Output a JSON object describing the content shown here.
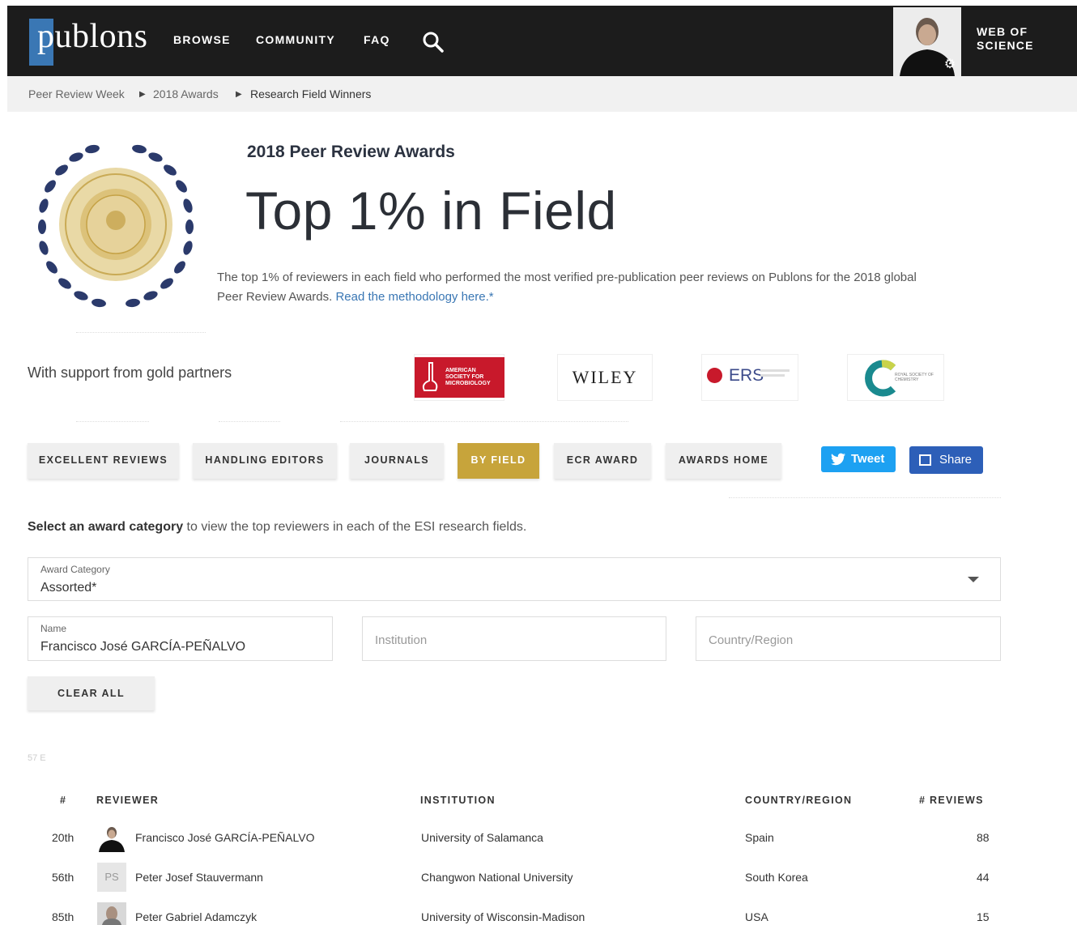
{
  "header": {
    "logo_text": "publons",
    "nav": [
      "BROWSE",
      "COMMUNITY",
      "FAQ"
    ],
    "wos_line1": "WEB OF",
    "wos_line2": "SCIENCE"
  },
  "breadcrumb": [
    "Peer Review Week",
    "2018 Awards",
    "Research Field Winners"
  ],
  "hero": {
    "kicker": "2018 Peer Review Awards",
    "title": "Top 1% in Field",
    "desc_text": "The top 1% of reviewers in each field who performed the most verified pre-publication peer reviews on Publons for the 2018 global Peer Review Awards.",
    "desc_link": "Read the methodology here.*"
  },
  "partners": {
    "label": "With support from gold partners",
    "asm_text": "AMERICAN SOCIETY FOR MICROBIOLOGY",
    "wiley": "WILEY",
    "ers": "ERS",
    "rsc": "ROYAL SOCIETY OF CHEMISTRY"
  },
  "tabs": [
    "EXCELLENT REVIEWS",
    "HANDLING EDITORS",
    "JOURNALS",
    "BY FIELD",
    "ECR AWARD",
    "AWARDS HOME"
  ],
  "social": {
    "tweet": "Tweet",
    "share": "Share"
  },
  "filters": {
    "intro_bold": "Select an award category",
    "intro_rest": " to view the top reviewers in each of the ESI research fields.",
    "category_label": "Award Category",
    "category_value": "Assorted*",
    "name_label": "Name",
    "name_value": "Francisco José GARCÍA-PEÑALVO",
    "institution_placeholder": "Institution",
    "country_placeholder": "Country/Region",
    "clear": "CLEAR ALL"
  },
  "result_count": "57 E",
  "table": {
    "headers": [
      "#",
      "REVIEWER",
      "INSTITUTION",
      "COUNTRY/REGION",
      "# REVIEWS"
    ],
    "rows": [
      {
        "rank": "20th",
        "initials": "",
        "name": "Francisco José GARCÍA-PEÑALVO",
        "institution": "University of Salamanca",
        "country": "Spain",
        "reviews": "88"
      },
      {
        "rank": "56th",
        "initials": "PS",
        "name": "Peter Josef Stauvermann",
        "institution": "Changwon National University",
        "country": "South Korea",
        "reviews": "44"
      },
      {
        "rank": "85th",
        "initials": "",
        "name": "Peter Gabriel Adamczyk",
        "institution": "University of Wisconsin-Madison",
        "country": "USA",
        "reviews": "15"
      }
    ]
  }
}
